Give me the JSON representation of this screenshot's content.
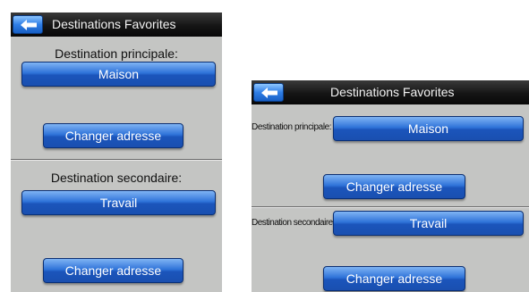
{
  "screen_a": {
    "title": "Destinations Favorites",
    "primary_label": "Destination principale:",
    "primary_button": "Maison",
    "primary_change": "Changer adresse",
    "secondary_label": "Destination secondaire:",
    "secondary_button": "Travail",
    "secondary_change": "Changer adresse"
  },
  "screen_b": {
    "title": "Destinations Favorites",
    "primary_label": "Destination principale:",
    "primary_button": "Maison",
    "primary_change": "Changer adresse",
    "secondary_label": "Destination secondaire:",
    "secondary_button": "Travail",
    "secondary_change": "Changer adresse"
  },
  "icons": {
    "back": "back-arrow-icon"
  },
  "colors": {
    "titlebar": "#151515",
    "button": "#2f73d9",
    "background": "#c4c5c3"
  }
}
